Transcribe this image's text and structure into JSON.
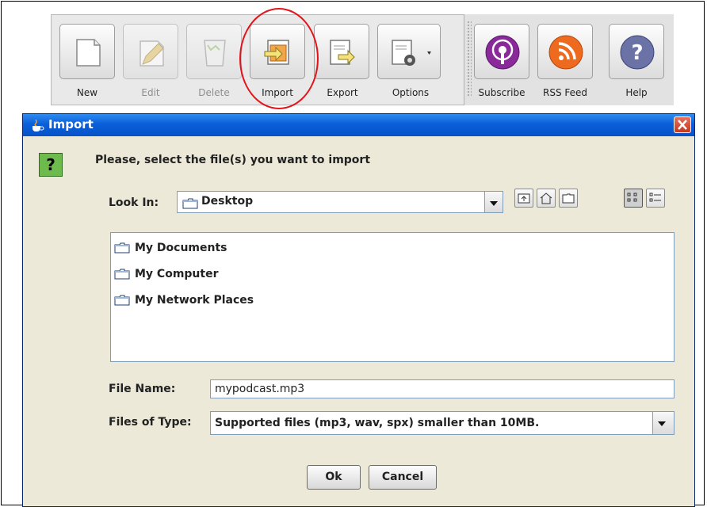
{
  "toolbar": {
    "buttons": [
      {
        "label": "New",
        "enabled": true,
        "icon": "new-document-icon"
      },
      {
        "label": "Edit",
        "enabled": false,
        "icon": "edit-pencil-icon"
      },
      {
        "label": "Delete",
        "enabled": false,
        "icon": "delete-bin-icon"
      },
      {
        "label": "Import",
        "enabled": true,
        "icon": "import-icon"
      },
      {
        "label": "Export",
        "enabled": true,
        "icon": "export-icon"
      },
      {
        "label": "Options",
        "enabled": true,
        "icon": "options-gear-icon"
      }
    ],
    "buttons2": [
      {
        "label": "Subscribe",
        "icon": "podcast-subscribe-icon"
      },
      {
        "label": "RSS Feed",
        "icon": "rss-feed-icon"
      },
      {
        "label": "Help",
        "icon": "help-question-icon"
      }
    ]
  },
  "dialog": {
    "title": "Import",
    "prompt": "Please, select the file(s) you want to import",
    "look_in_label": "Look In:",
    "look_in_value": "Desktop",
    "files": [
      "My Documents",
      "My Computer",
      "My Network Places"
    ],
    "file_name_label": "File Name:",
    "file_name_value": "mypodcast.mp3",
    "files_of_type_label": "Files of Type:",
    "files_of_type_value": "Supported files (mp3, wav, spx) smaller than 10MB.",
    "ok_label": "Ok",
    "cancel_label": "Cancel"
  },
  "colors": {
    "titlebar": "#0a5fd8",
    "highlight_circle": "#e2141a",
    "dialog_bg": "#ece9d8"
  }
}
